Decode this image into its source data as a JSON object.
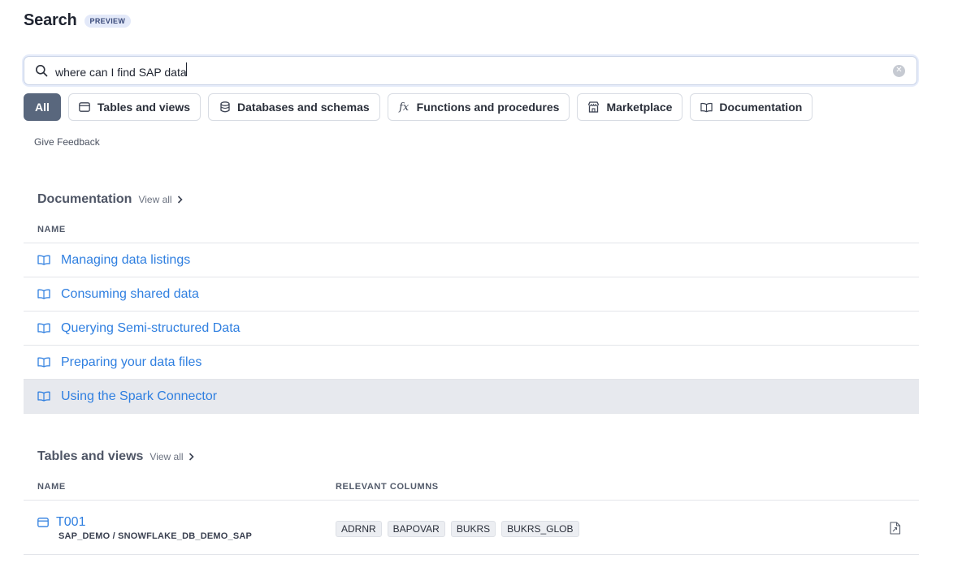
{
  "header": {
    "title": "Search",
    "badge": "PREVIEW"
  },
  "search": {
    "value": "where can I find SAP data"
  },
  "filters": [
    {
      "label": "All",
      "icon": null,
      "active": true
    },
    {
      "label": "Tables and views",
      "icon": "table-icon",
      "active": false
    },
    {
      "label": "Databases and schemas",
      "icon": "database-icon",
      "active": false
    },
    {
      "label": "Functions and procedures",
      "icon": "function-icon",
      "icon_text": "fx",
      "active": false
    },
    {
      "label": "Marketplace",
      "icon": "marketplace-icon",
      "active": false
    },
    {
      "label": "Documentation",
      "icon": "book-icon",
      "active": false
    }
  ],
  "feedback_label": "Give Feedback",
  "documentation": {
    "title": "Documentation",
    "view_all": "View all",
    "column_header": "NAME",
    "items": [
      {
        "label": "Managing data listings"
      },
      {
        "label": "Consuming shared data"
      },
      {
        "label": "Querying Semi-structured Data"
      },
      {
        "label": "Preparing your data files"
      },
      {
        "label": "Using the Spark Connector",
        "highlighted": true
      }
    ]
  },
  "tables": {
    "title": "Tables and views",
    "view_all": "View all",
    "column_headers": {
      "name": "NAME",
      "relevant_columns": "RELEVANT COLUMNS"
    },
    "rows": [
      {
        "name": "T001",
        "path": "SAP_DEMO / SNOWFLAKE_DB_DEMO_SAP",
        "columns": [
          "ADRNR",
          "BAPOVAR",
          "BUKRS",
          "BUKRS_GLOB"
        ]
      }
    ]
  },
  "colors": {
    "link": "#2f7fe0",
    "active_chip": "#59677d",
    "highlight_row": "#e7e9ee"
  }
}
